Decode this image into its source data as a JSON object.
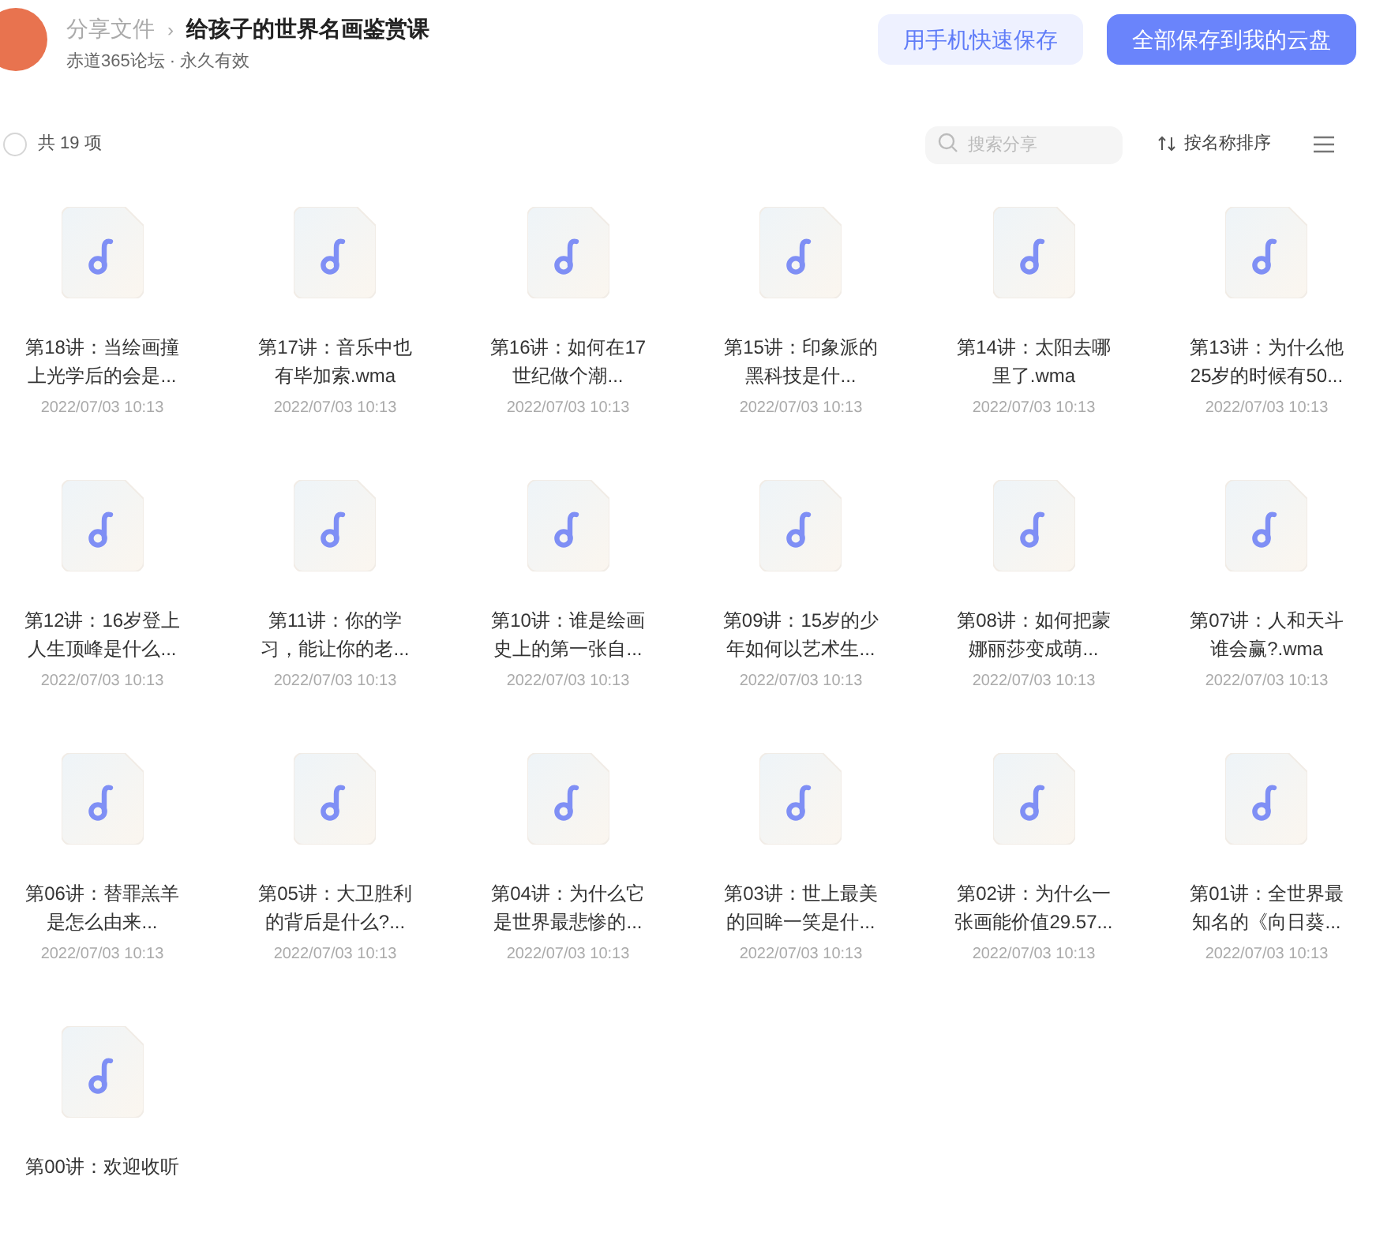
{
  "header": {
    "breadcrumb": "分享文件",
    "separator": "›",
    "title": "给孩子的世界名画鉴赏课",
    "subtitle": "赤道365论坛 · 永久有效",
    "buttons": [
      {
        "label": "用手机快速保存",
        "kind": "secondary"
      },
      {
        "label": "全部保存到我的云盘",
        "kind": "primary"
      }
    ]
  },
  "toolbar": {
    "select_all": {
      "checked": false
    },
    "count": "共 19 项",
    "search": {
      "placeholder": "搜索分享"
    },
    "sort": "按名称排序"
  },
  "files": [
    {
      "lines": [
        "第18讲：当绘画撞",
        "上光学后的会是..."
      ],
      "date": "2022/07/03 10:13"
    },
    {
      "lines": [
        "第17讲：音乐中也",
        "有毕加索.wma"
      ],
      "date": "2022/07/03 10:13"
    },
    {
      "lines": [
        "第16讲：如何在17",
        "世纪做个潮..."
      ],
      "date": "2022/07/03 10:13"
    },
    {
      "lines": [
        "第15讲：印象派的",
        "黑科技是什..."
      ],
      "date": "2022/07/03 10:13"
    },
    {
      "lines": [
        "第14讲：太阳去哪",
        "里了.wma"
      ],
      "date": "2022/07/03 10:13"
    },
    {
      "lines": [
        "第13讲：为什么他",
        "25岁的时候有50..."
      ],
      "date": "2022/07/03 10:13"
    },
    {
      "lines": [
        "第12讲：16岁登上",
        "人生顶峰是什么..."
      ],
      "date": "2022/07/03 10:13"
    },
    {
      "lines": [
        "第11讲：你的学",
        "习，能让你的老..."
      ],
      "date": "2022/07/03 10:13"
    },
    {
      "lines": [
        "第10讲：谁是绘画",
        "史上的第一张自..."
      ],
      "date": "2022/07/03 10:13"
    },
    {
      "lines": [
        "第09讲：15岁的少",
        "年如何以艺术生..."
      ],
      "date": "2022/07/03 10:13"
    },
    {
      "lines": [
        "第08讲：如何把蒙",
        "娜丽莎变成萌..."
      ],
      "date": "2022/07/03 10:13"
    },
    {
      "lines": [
        "第07讲：人和天斗",
        "谁会赢?.wma"
      ],
      "date": "2022/07/03 10:13"
    },
    {
      "lines": [
        "第06讲：替罪羔羊",
        "是怎么由来..."
      ],
      "date": "2022/07/03 10:13"
    },
    {
      "lines": [
        "第05讲：大卫胜利",
        "的背后是什么?..."
      ],
      "date": "2022/07/03 10:13"
    },
    {
      "lines": [
        "第04讲：为什么它",
        "是世界最悲惨的..."
      ],
      "date": "2022/07/03 10:13"
    },
    {
      "lines": [
        "第03讲：世上最美",
        "的回眸一笑是什..."
      ],
      "date": "2022/07/03 10:13"
    },
    {
      "lines": [
        "第02讲：为什么一",
        "张画能价值29.57..."
      ],
      "date": "2022/07/03 10:13"
    },
    {
      "lines": [
        "第01讲：全世界最",
        "知名的《向日葵..."
      ],
      "date": "2022/07/03 10:13"
    },
    {
      "lines": [
        "第00讲：欢迎收听"
      ]
    }
  ]
}
